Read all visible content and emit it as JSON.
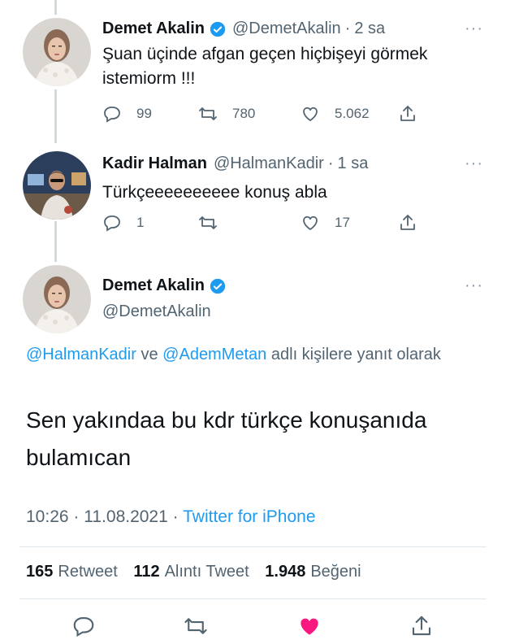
{
  "thread": [
    {
      "name": "Demet Akalin",
      "handle": "@DemetAkalin",
      "time": "2 sa",
      "text": "Şuan üçinde afgan geçen hiçbişeyi görmek istemiorm !!!",
      "replies": "99",
      "retweets": "780",
      "likes": "5.062",
      "verified": true
    },
    {
      "name": "Kadir Halman",
      "handle": "@HalmanKadir",
      "time": "1 sa",
      "text": "Türkçeeeeeeeeee konuş abla",
      "replies": "1",
      "retweets": "",
      "likes": "17",
      "verified": false
    }
  ],
  "main_tweet": {
    "name": "Demet Akalin",
    "handle": "@DemetAkalin",
    "replying_link1": "@HalmanKadir",
    "replying_mid": "ve",
    "replying_link2": "@AdemMetan",
    "replying_suffix": "adlı kişilere yanıt olarak",
    "text": "Sen yakındaa bu kdr türkçe konuşanıda bulamıcan",
    "time": "10:26",
    "date": "11.08.2021",
    "source": "Twitter for iPhone",
    "retweets_count": "165",
    "retweets_label": "Retweet",
    "quotes_count": "112",
    "quotes_label": "Alıntı Tweet",
    "likes_count": "1.948",
    "likes_label": "Beğeni"
  },
  "ui": {
    "more": "···",
    "separator": "·",
    "accent": "#1d9bf0",
    "like_active": "#f91880",
    "icons": [
      "reply-icon",
      "retweet-icon",
      "like-icon",
      "share-icon",
      "verified-badge-icon",
      "more-icon"
    ]
  }
}
